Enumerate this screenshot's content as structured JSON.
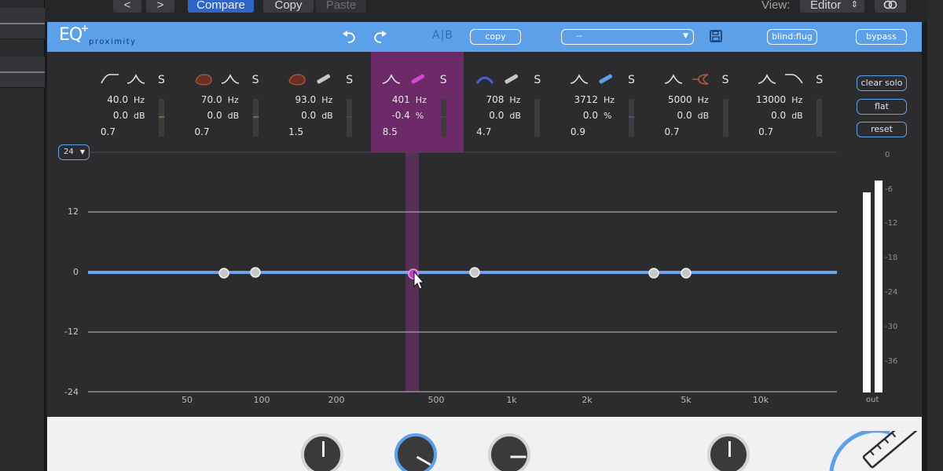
{
  "host": {
    "nav_back": "<",
    "nav_forward": ">",
    "compare": "Compare",
    "copy": "Copy",
    "paste": "Paste",
    "view_label": "View:",
    "view_value": "Editor"
  },
  "plugin": {
    "logo": "EQ",
    "logo_plus": "+",
    "logo_sub": "proximity",
    "ab": "A|B",
    "copy": "copy",
    "preset_value": "--",
    "blind": "blind:flug",
    "bypass": "bypass"
  },
  "bands": [
    {
      "freq": "40.0",
      "unit1": "Hz",
      "gain": "0.0",
      "unit2": "dB",
      "q": "0.7",
      "solo": "S"
    },
    {
      "freq": "70.0",
      "unit1": "Hz",
      "gain": "0.0",
      "unit2": "dB",
      "q": "0.7",
      "solo": "S"
    },
    {
      "freq": "93.0",
      "unit1": "Hz",
      "gain": "0.0",
      "unit2": "dB",
      "q": "1.5",
      "solo": "S"
    },
    {
      "freq": "401",
      "unit1": "Hz",
      "gain": "-0.4",
      "unit2": "%",
      "q": "8.5",
      "solo": "S"
    },
    {
      "freq": "708",
      "unit1": "Hz",
      "gain": "0.0",
      "unit2": "dB",
      "q": "4.7",
      "solo": "S"
    },
    {
      "freq": "3712",
      "unit1": "Hz",
      "gain": "0.0",
      "unit2": "%",
      "q": "0.9",
      "solo": "S"
    },
    {
      "freq": "5000",
      "unit1": "Hz",
      "gain": "0.0",
      "unit2": "dB",
      "q": "0.7",
      "solo": "S"
    },
    {
      "freq": "13000",
      "unit1": "Hz",
      "gain": "0.0",
      "unit2": "dB",
      "q": "0.7",
      "solo": "S"
    }
  ],
  "side": {
    "clear_solo": "clear solo",
    "flat": "flat",
    "reset": "reset"
  },
  "range": "24",
  "graph": {
    "gain_labels": [
      "12",
      "0",
      "-12",
      "-24"
    ],
    "freq_labels": [
      "50",
      "100",
      "200",
      "500",
      "1k",
      "2k",
      "5k",
      "10k"
    ],
    "meter_labels": [
      "0",
      "-6",
      "-12",
      "-18",
      "-24",
      "-30",
      "-36"
    ],
    "out_label": "out",
    "meter_levels": [
      0.85,
      0.9
    ]
  },
  "colors": {
    "accent": "#5da0ea",
    "selected_band": "#6d2a69",
    "curve": "#6ea2ea",
    "node_selected": "#c040c0"
  }
}
